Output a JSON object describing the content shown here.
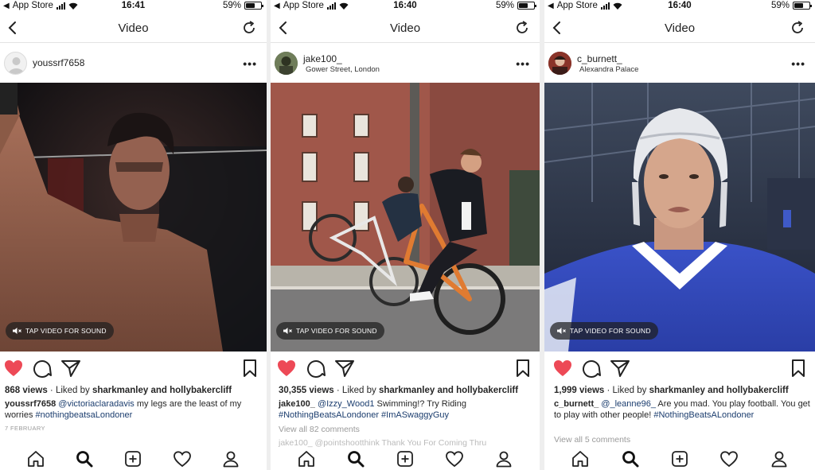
{
  "status_bars": [
    {
      "back_app": "App Store",
      "time": "16:41",
      "battery": "59%"
    },
    {
      "back_app": "App Store",
      "time": "16:40",
      "battery": "59%"
    },
    {
      "back_app": "App Store",
      "time": "16:40",
      "battery": "59%"
    }
  ],
  "nav": {
    "title": "Video"
  },
  "video": {
    "sound_label": "TAP VIDEO FOR SOUND"
  },
  "posts": [
    {
      "username": "youssrf7658",
      "location": "",
      "views": "868 views",
      "liked_prefix": " · Liked by ",
      "liked_by": "sharkmanley and hollybakercliff",
      "caption_user": "youssrf7658",
      "caption_text_a": " @victoriaclaradavis",
      "caption_text_b": " my legs are the least of my worries ",
      "caption_tag": "#nothingbeatsaLondoner",
      "date": "7 FEBRUARY"
    },
    {
      "username": "jake100_",
      "location": "Gower Street, London",
      "views": "30,355 views",
      "liked_prefix": " · Liked by ",
      "liked_by": "sharkmanley and hollybakercliff",
      "caption_user": "jake100_",
      "caption_text_a": " @Izzy_Wood1",
      "caption_text_b": " Swimming!? Try Riding ",
      "caption_tag": "#NothingBeatsALondoner #ImASwaggyGuy",
      "comments": "View all 82 comments",
      "next_comment": "jake100_  @pointshootthink Thank You For Coming Thru"
    },
    {
      "username": "c_burnett_",
      "location": "Alexandra Palace",
      "views": "1,999 views",
      "liked_prefix": " · Liked by ",
      "liked_by": "sharkmanley and hollybakercliff",
      "caption_user": "c_burnett_",
      "caption_text_a": " @_leanne96_",
      "caption_text_b": " Are you mad. You play football. You get to play with other people! ",
      "caption_tag": "#NothingBeatsALondoner",
      "comments": "View all 5 comments"
    }
  ],
  "colors": {
    "heart": "#ed4956",
    "link": "#1b3d6e",
    "muted": "#9a9a9a"
  },
  "icons": [
    "back-icon",
    "refresh-icon",
    "more-icon",
    "heart-icon",
    "comment-icon",
    "share-icon",
    "bookmark-icon",
    "home-icon",
    "search-icon",
    "add-icon",
    "activity-icon",
    "profile-icon",
    "speaker-muted-icon"
  ]
}
